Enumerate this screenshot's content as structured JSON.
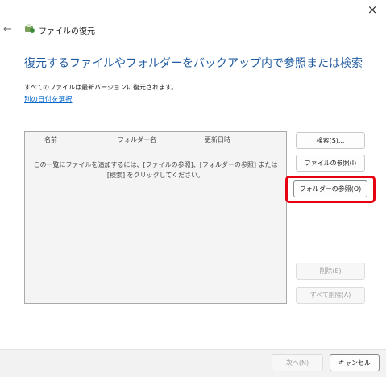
{
  "window": {
    "close_glyph": "×",
    "back_glyph": "←",
    "title": "ファイルの復元",
    "app_icon": "file-recovery-icon"
  },
  "main": {
    "heading": "復元するファイルやフォルダーをバックアップ内で参照または検索",
    "info": "すべてのファイルは最新バージョンに復元されます。",
    "date_link": "別の日付を選択"
  },
  "list": {
    "columns": [
      "名前",
      "フォルダー名",
      "更新日時"
    ],
    "empty_message": "この一覧にファイルを追加するには、[ファイルの参照]、[フォルダーの参照] または [検索] をクリックしてください。"
  },
  "buttons": {
    "search": "検索(S)...",
    "browse_files": "ファイルの参照(I)",
    "browse_folders": "フォルダーの参照(O)",
    "delete": "削除(E)",
    "delete_all": "すべて削除(A)",
    "next": "次へ(N)",
    "cancel": "キャンセル"
  },
  "colors": {
    "heading": "#1e5aa0",
    "link": "#0066cc",
    "highlight": "#e60012"
  }
}
